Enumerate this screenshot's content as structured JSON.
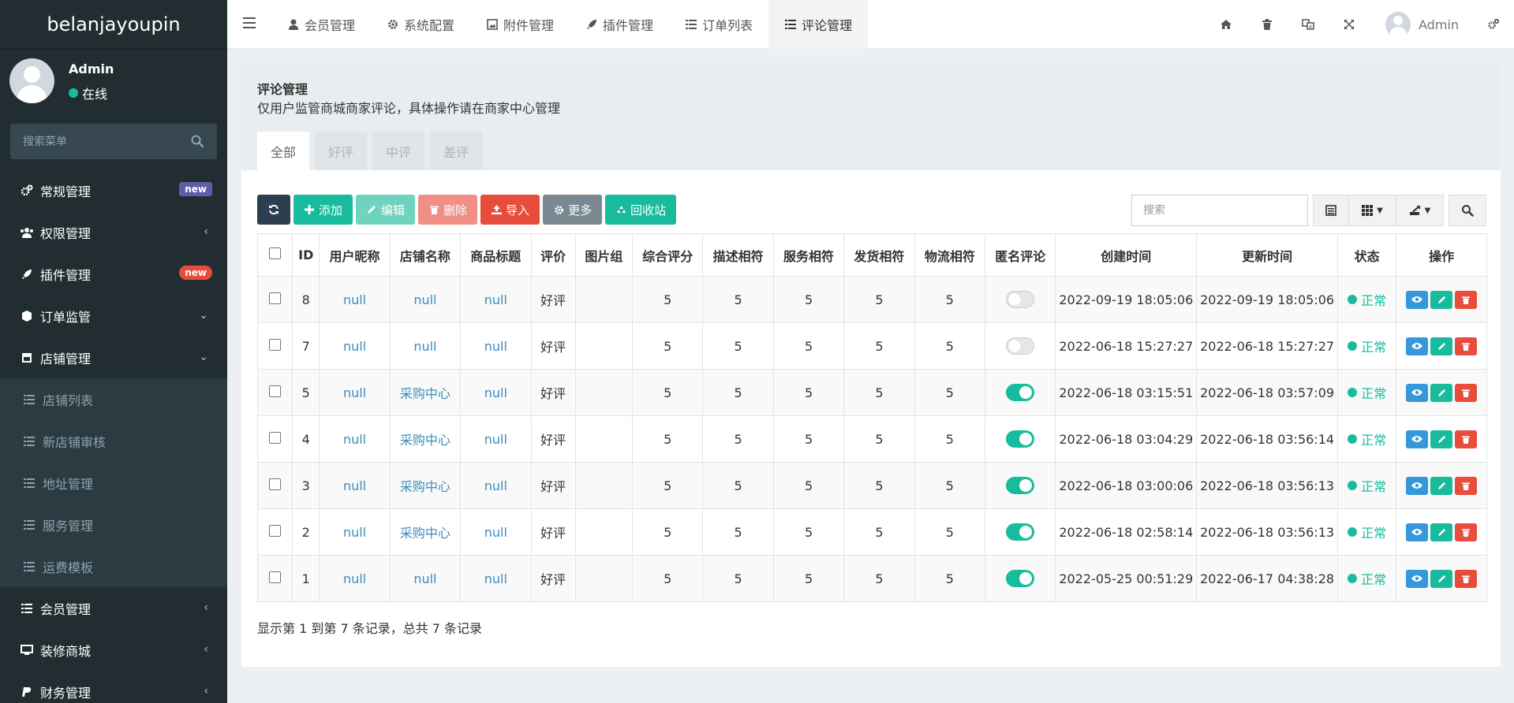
{
  "app": {
    "title": "belanjayoupin"
  },
  "user": {
    "name": "Admin",
    "status": "在线"
  },
  "sidebar": {
    "search_placeholder": "搜索菜单",
    "items": [
      {
        "label": "常规管理",
        "icon": "gears-icon",
        "badge": "new"
      },
      {
        "label": "权限管理",
        "icon": "users-icon"
      },
      {
        "label": "插件管理",
        "icon": "rocket-icon",
        "badge": "new"
      },
      {
        "label": "订单监管",
        "icon": "cube-icon"
      },
      {
        "label": "店铺管理",
        "icon": "store-icon"
      },
      {
        "label": "会员管理",
        "icon": "list-icon"
      },
      {
        "label": "装修商城",
        "icon": "desktop-icon"
      },
      {
        "label": "财务管理",
        "icon": "paypal-icon"
      }
    ],
    "submenu": [
      {
        "label": "店铺列表"
      },
      {
        "label": "新店铺审核"
      },
      {
        "label": "地址管理"
      },
      {
        "label": "服务管理"
      },
      {
        "label": "运费模板"
      }
    ]
  },
  "navbar": {
    "tabs": [
      {
        "label": "会员管理",
        "icon": "user-icon"
      },
      {
        "label": "系统配置",
        "icon": "gear-icon"
      },
      {
        "label": "附件管理",
        "icon": "image-icon"
      },
      {
        "label": "插件管理",
        "icon": "rocket-icon"
      },
      {
        "label": "订单列表",
        "icon": "list-icon"
      },
      {
        "label": "评论管理",
        "icon": "list-icon",
        "active": true
      }
    ],
    "user_name": "Admin"
  },
  "page": {
    "title": "评论管理",
    "description": "仅用户监管商城商家评论，具体操作请在商家中心管理",
    "tabs": [
      "全部",
      "好评",
      "中评",
      "差评"
    ],
    "active_tab": "全部"
  },
  "toolbar": {
    "add": "添加",
    "edit": "编辑",
    "delete": "删除",
    "import": "导入",
    "more": "更多",
    "recycle": "回收站",
    "search_placeholder": "搜索"
  },
  "table": {
    "columns": [
      "ID",
      "用户昵称",
      "店铺名称",
      "商品标题",
      "评价",
      "图片组",
      "综合评分",
      "描述相符",
      "服务相符",
      "发货相符",
      "物流相符",
      "匿名评论",
      "创建时间",
      "更新时间",
      "状态",
      "操作"
    ],
    "rows": [
      {
        "id": "8",
        "nickname": "null",
        "shop": "null",
        "title": "null",
        "rating": "好评",
        "images": "",
        "overall": "5",
        "desc": "5",
        "service": "5",
        "delivery": "5",
        "logistics": "5",
        "anonymous": false,
        "created": "2022-09-19 18:05:06",
        "updated": "2022-09-19 18:05:06",
        "status": "正常"
      },
      {
        "id": "7",
        "nickname": "null",
        "shop": "null",
        "title": "null",
        "rating": "好评",
        "images": "",
        "overall": "5",
        "desc": "5",
        "service": "5",
        "delivery": "5",
        "logistics": "5",
        "anonymous": false,
        "created": "2022-06-18 15:27:27",
        "updated": "2022-06-18 15:27:27",
        "status": "正常"
      },
      {
        "id": "5",
        "nickname": "null",
        "shop": "采购中心",
        "title": "null",
        "rating": "好评",
        "images": "",
        "overall": "5",
        "desc": "5",
        "service": "5",
        "delivery": "5",
        "logistics": "5",
        "anonymous": true,
        "created": "2022-06-18 03:15:51",
        "updated": "2022-06-18 03:57:09",
        "status": "正常"
      },
      {
        "id": "4",
        "nickname": "null",
        "shop": "采购中心",
        "title": "null",
        "rating": "好评",
        "images": "",
        "overall": "5",
        "desc": "5",
        "service": "5",
        "delivery": "5",
        "logistics": "5",
        "anonymous": true,
        "created": "2022-06-18 03:04:29",
        "updated": "2022-06-18 03:56:14",
        "status": "正常"
      },
      {
        "id": "3",
        "nickname": "null",
        "shop": "采购中心",
        "title": "null",
        "rating": "好评",
        "images": "",
        "overall": "5",
        "desc": "5",
        "service": "5",
        "delivery": "5",
        "logistics": "5",
        "anonymous": true,
        "created": "2022-06-18 03:00:06",
        "updated": "2022-06-18 03:56:13",
        "status": "正常"
      },
      {
        "id": "2",
        "nickname": "null",
        "shop": "采购中心",
        "title": "null",
        "rating": "好评",
        "images": "",
        "overall": "5",
        "desc": "5",
        "service": "5",
        "delivery": "5",
        "logistics": "5",
        "anonymous": true,
        "created": "2022-06-18 02:58:14",
        "updated": "2022-06-18 03:56:13",
        "status": "正常"
      },
      {
        "id": "1",
        "nickname": "null",
        "shop": "null",
        "title": "null",
        "rating": "好评",
        "images": "",
        "overall": "5",
        "desc": "5",
        "service": "5",
        "delivery": "5",
        "logistics": "5",
        "anonymous": true,
        "created": "2022-05-25 00:51:29",
        "updated": "2022-06-17 04:38:28",
        "status": "正常"
      }
    ]
  },
  "pagination": {
    "info": "显示第 1 到第 7 条记录，总共 7 条记录"
  },
  "colors": {
    "sidebar_bg": "#222d32",
    "accent_green": "#18bc9c",
    "danger": "#e74c3c",
    "info": "#3498db"
  }
}
